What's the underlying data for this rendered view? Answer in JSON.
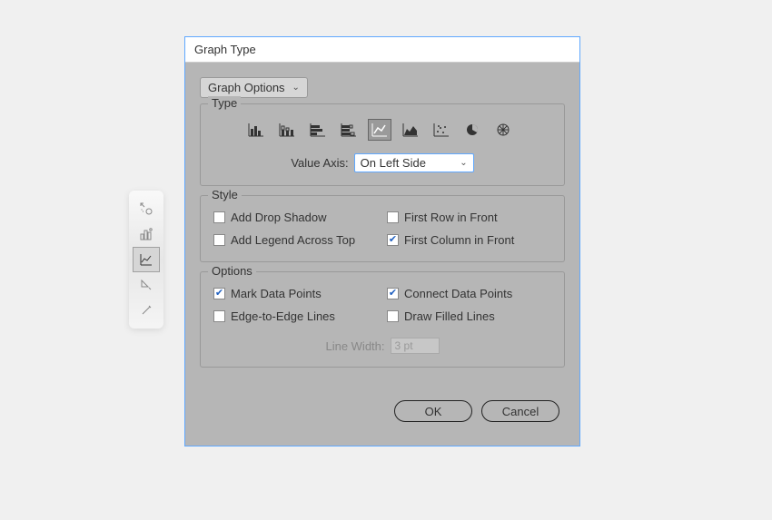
{
  "dialog": {
    "title": "Graph Type",
    "dropdown": "Graph Options",
    "ok": "OK",
    "cancel": "Cancel"
  },
  "type_section": {
    "legend": "Type",
    "value_axis_label": "Value Axis:",
    "value_axis_value": "On Left Side"
  },
  "style_section": {
    "legend": "Style",
    "add_drop_shadow": "Add Drop Shadow",
    "first_row_front": "First Row in Front",
    "add_legend_across_top": "Add Legend Across Top",
    "first_column_front": "First Column in Front"
  },
  "options_section": {
    "legend": "Options",
    "mark_data_points": "Mark Data Points",
    "connect_data_points": "Connect Data Points",
    "edge_to_edge": "Edge-to-Edge Lines",
    "draw_filled": "Draw Filled Lines",
    "line_width_label": "Line Width:",
    "line_width_value": "3 pt"
  }
}
